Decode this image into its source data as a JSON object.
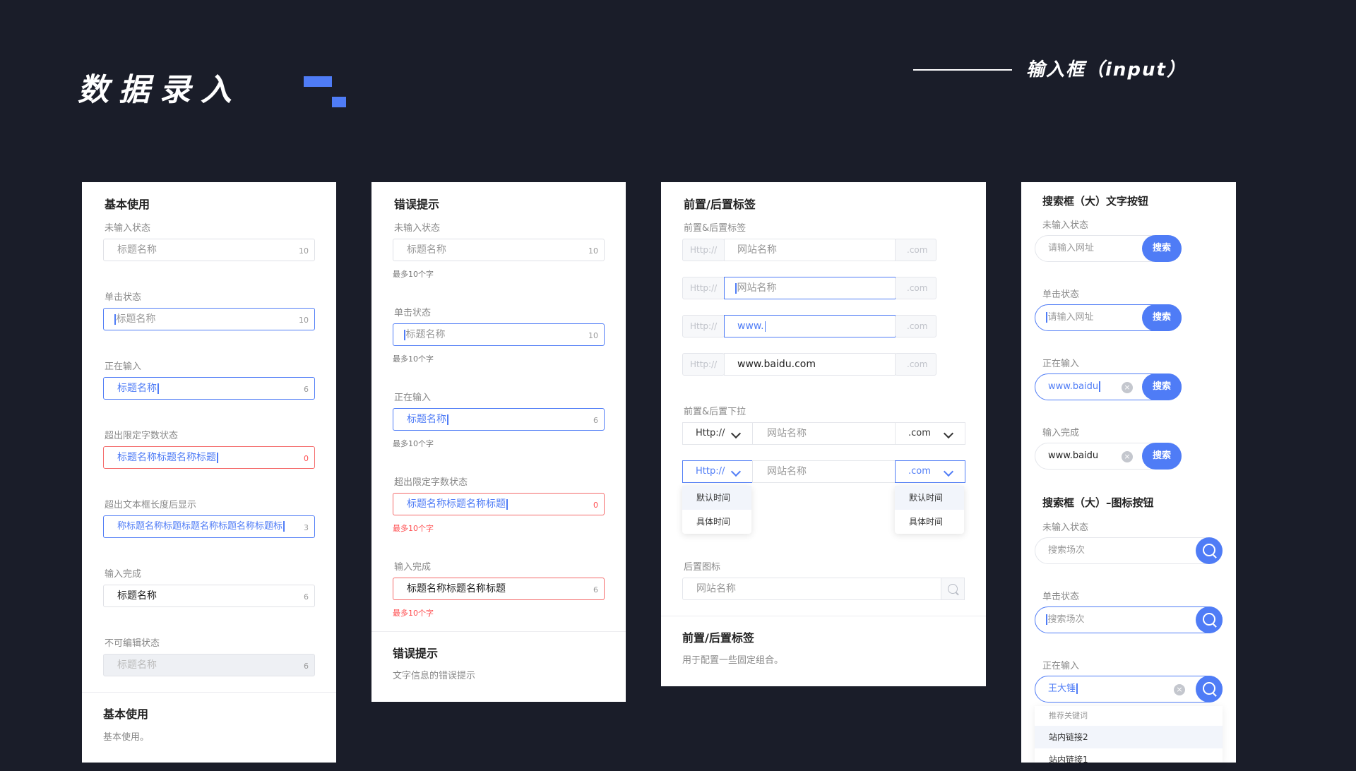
{
  "header": {
    "title": "数据录入",
    "section": "输入框（input）"
  },
  "card1": {
    "title": "基本使用",
    "states": [
      {
        "label": "未输入状态",
        "text": "标题名称",
        "count": "10"
      },
      {
        "label": "单击状态",
        "text": "标题名称",
        "count": "10"
      },
      {
        "label": "正在输入",
        "text": "标题名称",
        "count": "6"
      },
      {
        "label": "超出限定字数状态",
        "text": "标题名称标题名称标题",
        "count": "0"
      },
      {
        "label": "超出文本框长度后显示",
        "text": "称标题名称标题标题名称标题名称标题标",
        "count": "3"
      },
      {
        "label": "输入完成",
        "text": "标题名称",
        "count": "6"
      },
      {
        "label": "不可编辑状态",
        "text": "标题名称",
        "count": "6"
      }
    ],
    "footer_title": "基本使用",
    "footer_desc": "基本使用。"
  },
  "card2": {
    "title": "错误提示",
    "states": [
      {
        "label": "未输入状态",
        "text": "标题名称",
        "count": "10",
        "tip": "最多10个字"
      },
      {
        "label": "单击状态",
        "text": "标题名称",
        "count": "10",
        "tip": "最多10个字"
      },
      {
        "label": "正在输入",
        "text": "标题名称",
        "count": "6",
        "tip": "最多10个字"
      },
      {
        "label": "超出限定字数状态",
        "text": "标题名称标题名称标题",
        "count": "0",
        "tip": "最多10个字"
      },
      {
        "label": "输入完成",
        "text": "标题名称标题名称标题",
        "count": "6",
        "tip": "最多10个字"
      }
    ],
    "footer_title": "错误提示",
    "footer_desc": "文字信息的错误提示"
  },
  "card3": {
    "title": "前置/后置标签",
    "addon_label": "前置&后置标签",
    "prefix": "Http://",
    "suffix": ".com",
    "rows": [
      {
        "text": "网站名称"
      },
      {
        "text": "网站名称"
      },
      {
        "text": "www."
      },
      {
        "text": "www.baidu.com"
      }
    ],
    "select_label": "前置&后置下拉",
    "select_prefix": "Http://",
    "select_suffix": ".com",
    "select_placeholder": "网站名称",
    "dropdown_items": [
      "默认时间",
      "具体时间"
    ],
    "icon_label": "后置图标",
    "icon_placeholder": "网站名称",
    "footer_title": "前置/后置标签",
    "footer_desc": "用于配置一些固定组合。"
  },
  "card4": {
    "title": "搜索框（大）文字按钮",
    "button": "搜索",
    "text_states": [
      {
        "label": "未输入状态",
        "text": "请输入网址"
      },
      {
        "label": "单击状态",
        "text": "请输入网址"
      },
      {
        "label": "正在输入",
        "text": "www.baidu"
      },
      {
        "label": "输入完成",
        "text": "www.baidu"
      }
    ],
    "icon_title": "搜索框（大）–图标按钮",
    "icon_states": [
      {
        "label": "未输入状态",
        "text": "搜索场次"
      },
      {
        "label": "单击状态",
        "text": "搜索场次"
      },
      {
        "label": "正在输入",
        "text": "王大锤"
      }
    ],
    "suggest_head": "推荐关键词",
    "suggest_items": [
      "站内链接2",
      "站内链接1"
    ]
  },
  "colors": {
    "background": "#1a1d29",
    "accent": "#4f7cf6",
    "error": "#ff4d4f"
  }
}
